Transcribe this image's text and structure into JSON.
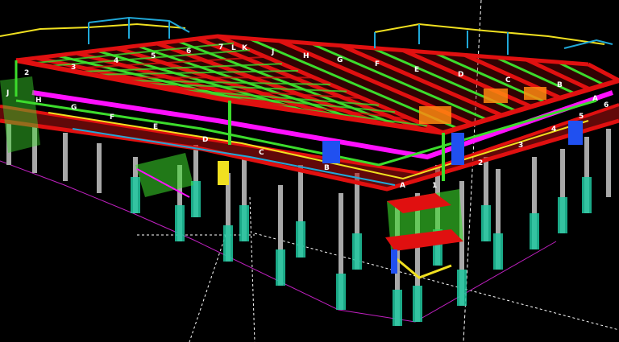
{
  "viewport": {
    "background": "#000000",
    "colors": {
      "beam_primary": "#e01010",
      "beam_secondary": "#3cdc2c",
      "brace": "#ff10ff",
      "joist": "#f0e020",
      "column": "#a8a8a8",
      "base_plate": "#20c8a0",
      "rail": "#20a8d8",
      "blue_member": "#2050f0",
      "orange_deck": "#ff8810",
      "outline": "#d020d0"
    }
  },
  "grid_labels": {
    "numbers": [
      "1",
      "2",
      "3",
      "4",
      "5",
      "6",
      "7"
    ],
    "letters": [
      "A",
      "B",
      "C",
      "D",
      "E",
      "F",
      "G",
      "H",
      "J",
      "K",
      "L"
    ]
  },
  "labels": {
    "roof_numbers": {
      "l2": "2",
      "l3": "3",
      "l4": "4",
      "l5": "5",
      "l6": "6",
      "l7": "7"
    },
    "roof_letters": {
      "L": "L",
      "K": "K",
      "J": "J",
      "H": "H",
      "G": "G",
      "F": "F",
      "E": "E",
      "D": "D",
      "C": "C",
      "B": "B",
      "A": "A"
    },
    "right_numbers": {
      "r6": "6",
      "r5": "5",
      "r4": "4",
      "r3": "3",
      "r2": "2",
      "r1": "1"
    },
    "left_letters": {
      "J": "J",
      "H": "H",
      "G": "G",
      "F": "F",
      "E": "E",
      "D": "D",
      "C": "C",
      "B": "B",
      "A": "A"
    }
  }
}
